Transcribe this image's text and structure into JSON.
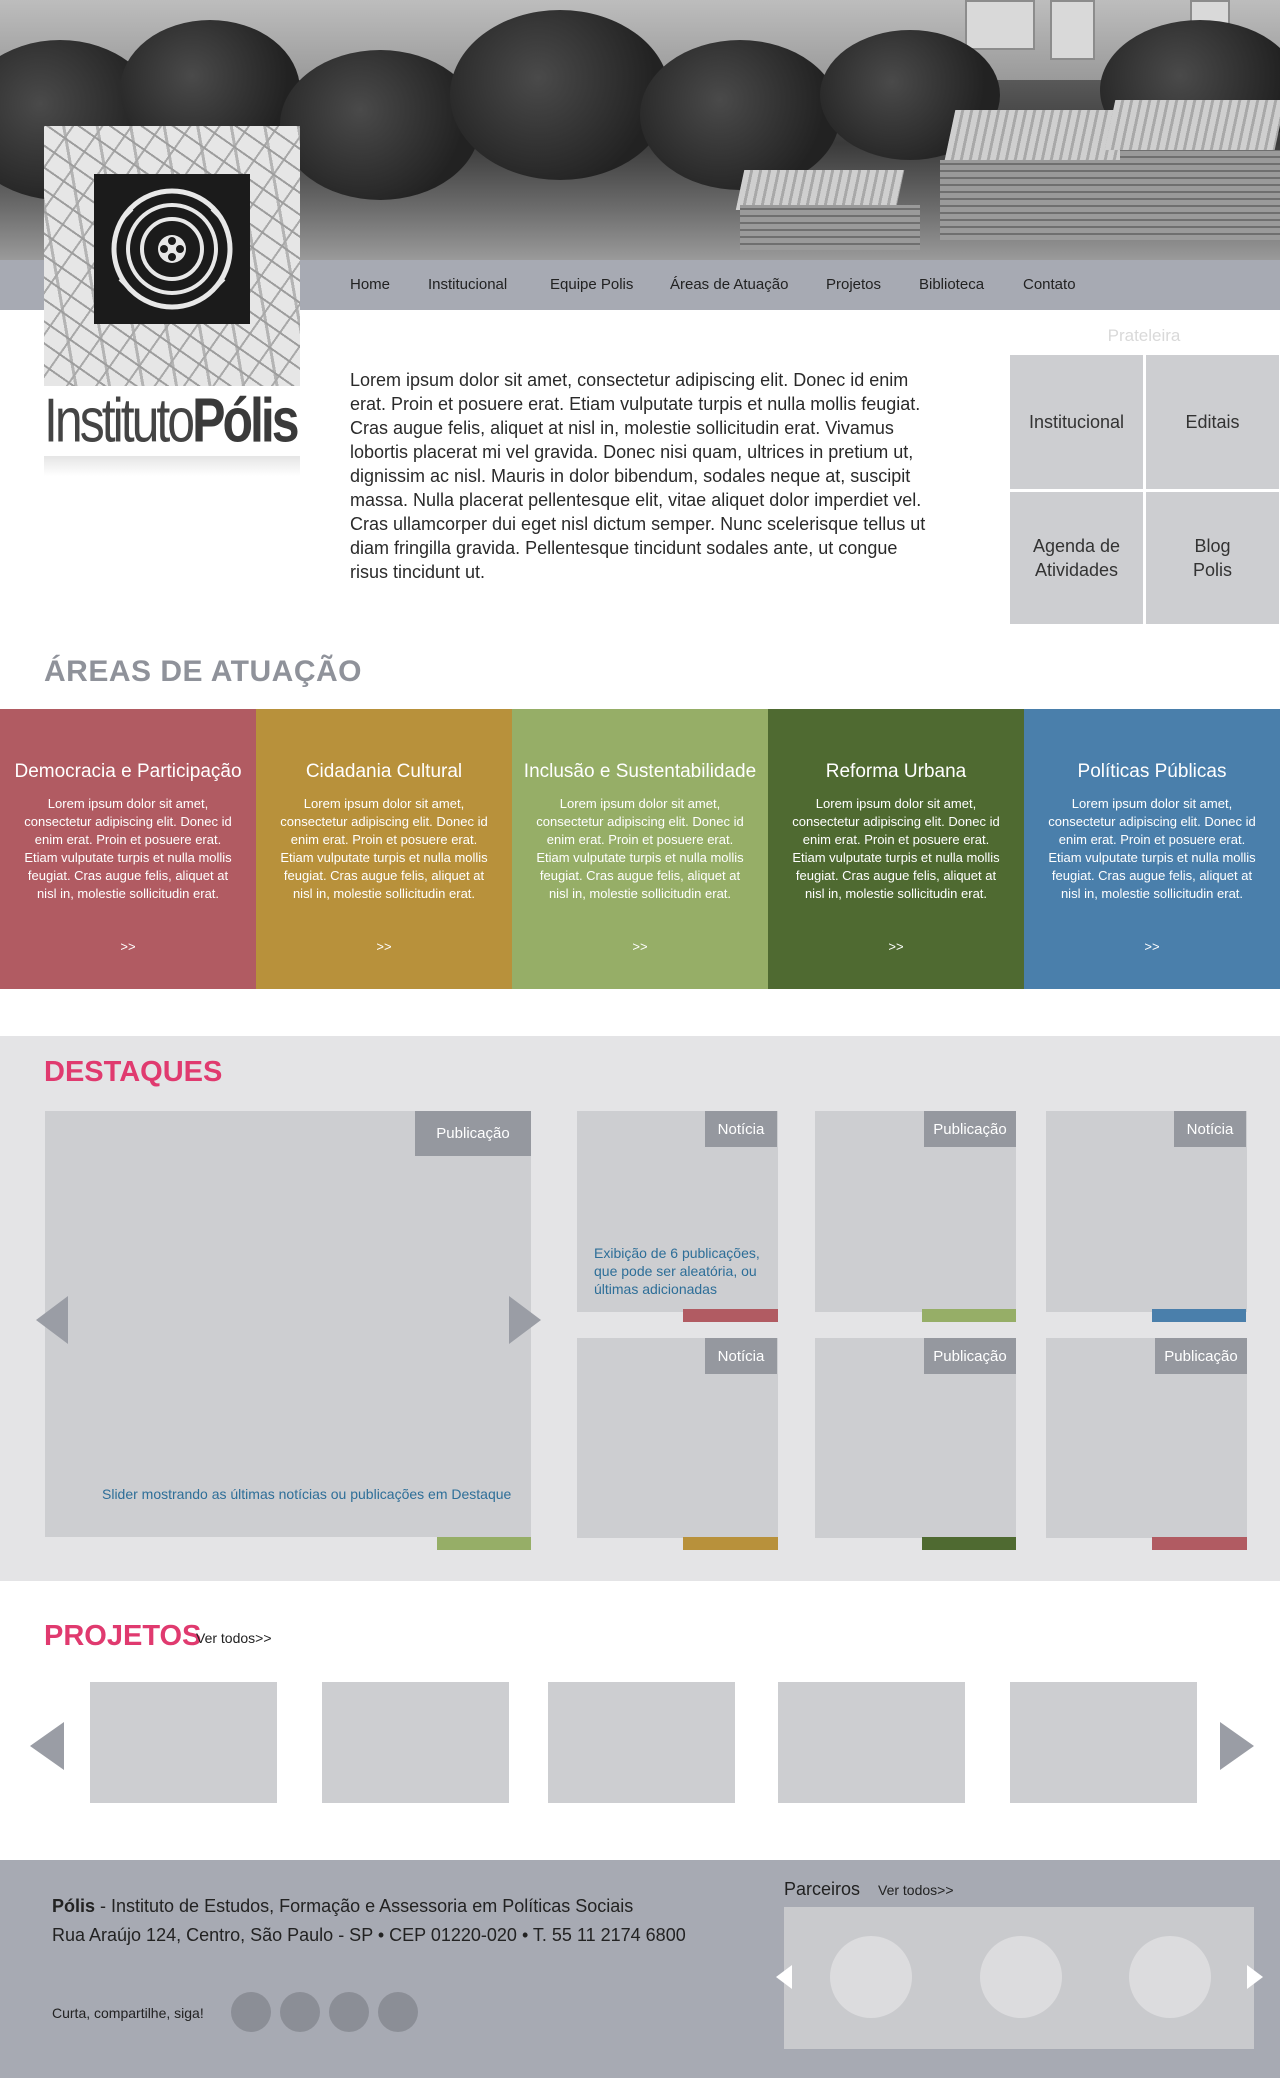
{
  "nav": {
    "items": [
      "Home",
      "Institucional",
      "Equipe Polis",
      "Áreas de Atuação",
      "Projetos",
      "Biblioteca",
      "Contato"
    ]
  },
  "logo": {
    "part1": "Instituto",
    "part2": "Pólis"
  },
  "intro": {
    "text": "Lorem ipsum dolor sit amet, consectetur adipiscing elit. Donec id enim erat. Proin et posuere erat. Etiam vulputate turpis et nulla mollis feugiat. Cras augue felis, aliquet at nisl in, molestie sollicitudin erat. Vivamus lobortis placerat mi vel gravida. Donec nisi quam, ultrices in pretium ut, dignissim ac nisl. Mauris in dolor bibendum, sodales neque at, suscipit massa. Nulla placerat pellentesque elit, vitae aliquet dolor imperdiet vel. Cras ullamcorper dui eget nisl dictum semper. Nunc scelerisque tellus ut diam fringilla gravida. Pellentesque tincidunt sodales ante, ut congue risus tincidunt ut."
  },
  "shelf": {
    "title": "Prateleira",
    "tiles": [
      "Institucional",
      "Editais",
      "Agenda de Atividades",
      "Blog Polis"
    ]
  },
  "areas": {
    "heading": "ÁREAS DE ATUAÇÃO",
    "description": "Lorem ipsum dolor sit amet, consectetur adipiscing elit. Donec id enim erat. Proin et posuere erat. Etiam vulputate turpis et nulla mollis feugiat. Cras augue felis, aliquet at nisl in, molestie sollicitudin erat.",
    "more": ">>",
    "items": [
      {
        "title": "Democracia e Participação",
        "color": "#b15b62"
      },
      {
        "title": "Cidadania Cultural",
        "color": "#b8913b"
      },
      {
        "title": "Inclusão e Sustentabilidade",
        "color": "#96ae67"
      },
      {
        "title": "Reforma Urbana",
        "color": "#4f6a31"
      },
      {
        "title": "Políticas Públicas",
        "color": "#4a7fab"
      }
    ]
  },
  "destaques": {
    "title": "DESTAQUES",
    "slider_tag": "Publicação",
    "slider_note": "Slider mostrando as últimas notícias ou publicações em Destaque",
    "grid_note": "Exibição de 6 publicações, que pode ser aleatória, ou últimas adicionadas",
    "cards": [
      {
        "tag": "Notícia",
        "stripe": "#b15b62"
      },
      {
        "tag": "Publicação",
        "stripe": "#96ae67"
      },
      {
        "tag": "Notícia",
        "stripe": "#4a7fab"
      },
      {
        "tag": "Notícia",
        "stripe": "#b8913b"
      },
      {
        "tag": "Publicação",
        "stripe": "#4f6a31"
      },
      {
        "tag": "Publicação",
        "stripe": "#b15b62"
      }
    ],
    "slider_stripe": "#96ae67"
  },
  "projetos": {
    "title": "PROJETOS",
    "ver_todos": "Ver todos>>"
  },
  "footer": {
    "org_name": "Pólis",
    "org_desc": " - Instituto de Estudos, Formação e Assessoria em Políticas Sociais",
    "address": "Rua Araújo 124, Centro, São Paulo - SP  •  CEP 01220-020  •  T. 55 11 2174 6800",
    "social_label": "Curta, compartilhe, siga!",
    "partners_title": "Parceiros",
    "partners_ver_todos": "Ver todos>>"
  },
  "colors": {
    "accent": "#e03a6f",
    "nav": "#a7aab3",
    "placeholder": "#cdced1",
    "note": "#2d6e98"
  }
}
